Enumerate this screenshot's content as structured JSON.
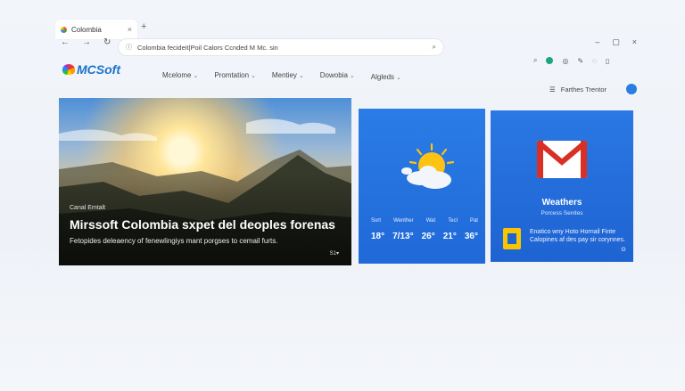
{
  "browser": {
    "tab_title": "Colombia",
    "new_tab_symbol": "+",
    "close_symbol": "×",
    "address_text": "Colombia fecideit|Poil Calors Ccnded M Mc. sin",
    "window_controls": [
      "–",
      "▢",
      "×"
    ],
    "nav_icons": [
      "back-icon",
      "forward-icon",
      "refresh-icon"
    ],
    "toolbar_icons": [
      "zoom-icon",
      "extension-icon",
      "settings-icon",
      "pen-icon",
      "favorites-icon",
      "collections-icon"
    ]
  },
  "site": {
    "logo_text": "MCSoft",
    "menu": [
      {
        "label": "Mcelome"
      },
      {
        "label": "Promtation"
      },
      {
        "label": "Mentiey"
      },
      {
        "label": "Dowobia"
      },
      {
        "label": "Algleds"
      }
    ],
    "right_link": "Farthes Trentor"
  },
  "hero": {
    "kicker": "Canal Emtalt",
    "headline": "Mirssoft Colombia sxpet del deoples forenas",
    "subtitle": "Fetopides deleaency of fenewlingiys mant porgses to cemail furts.",
    "more": "S1▾"
  },
  "weather": {
    "days": [
      "Sort",
      "Wenther",
      "Wat",
      "Tecl",
      "Pat"
    ],
    "temps": [
      "18°",
      "7/13°",
      "26°",
      "21°",
      "36°"
    ],
    "sun_color": "#fdc313",
    "cloud_color": "#f2f6fb"
  },
  "mail": {
    "title": "Weathers",
    "subtitle": "Porcess Senites",
    "description": "Enatico wny Hoto Hornail Finte Calopines af des pay sir corynnes.",
    "accent": "#d93025"
  }
}
